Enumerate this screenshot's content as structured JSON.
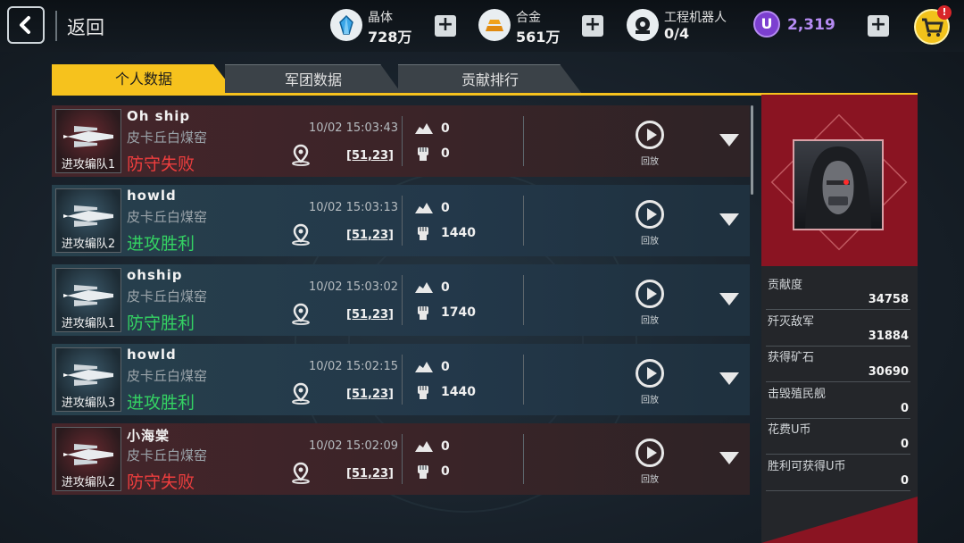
{
  "header": {
    "back_label": "返回",
    "resources": [
      {
        "name": "晶体",
        "value": "728万",
        "icon": "crystal-icon"
      },
      {
        "name": "合金",
        "value": "561万",
        "icon": "alloy-icon"
      },
      {
        "name": "工程机器人",
        "value": "0/4",
        "icon": "robot-icon"
      }
    ],
    "currency_symbol": "U",
    "currency_value": "2,319",
    "cart_badge": "!"
  },
  "tabs": [
    {
      "label": "个人数据",
      "active": true
    },
    {
      "label": "军团数据",
      "active": false
    },
    {
      "label": "贡献排行",
      "active": false
    }
  ],
  "records": [
    {
      "team": "进攻编队1",
      "player": "Oh ship",
      "mine": "皮卡丘白煤窑",
      "result": "防守失败",
      "outcome": "lose",
      "time": "10/02 15:03:43",
      "coord": "[51,23]",
      "ore": "0",
      "kills": "0",
      "replay": "回放"
    },
    {
      "team": "进攻编队2",
      "player": "howld",
      "mine": "皮卡丘白煤窑",
      "result": "进攻胜利",
      "outcome": "win",
      "time": "10/02 15:03:13",
      "coord": "[51,23]",
      "ore": "0",
      "kills": "1440",
      "replay": "回放"
    },
    {
      "team": "进攻编队1",
      "player": "ohship",
      "mine": "皮卡丘白煤窑",
      "result": "防守胜利",
      "outcome": "win",
      "time": "10/02 15:03:02",
      "coord": "[51,23]",
      "ore": "0",
      "kills": "1740",
      "replay": "回放"
    },
    {
      "team": "进攻编队3",
      "player": "howld",
      "mine": "皮卡丘白煤窑",
      "result": "进攻胜利",
      "outcome": "win",
      "time": "10/02 15:02:15",
      "coord": "[51,23]",
      "ore": "0",
      "kills": "1440",
      "replay": "回放"
    },
    {
      "team": "进攻编队2",
      "player": "小海棠",
      "mine": "皮卡丘白煤窑",
      "result": "防守失败",
      "outcome": "lose",
      "time": "10/02 15:02:09",
      "coord": "[51,23]",
      "ore": "0",
      "kills": "0",
      "replay": "回放"
    }
  ],
  "stats": [
    {
      "label": "贡献度",
      "value": "34758"
    },
    {
      "label": "歼灭敌军",
      "value": "31884"
    },
    {
      "label": "获得矿石",
      "value": "30690"
    },
    {
      "label": "击毁殖民舰",
      "value": "0"
    },
    {
      "label": "花费U币",
      "value": "0"
    },
    {
      "label": "胜利可获得U币",
      "value": "0"
    }
  ],
  "colors": {
    "accent": "#f6c21d",
    "lose": "#ee3e3e",
    "win": "#34d263",
    "panel": "#8a1422",
    "currency": "#b58bf2"
  }
}
